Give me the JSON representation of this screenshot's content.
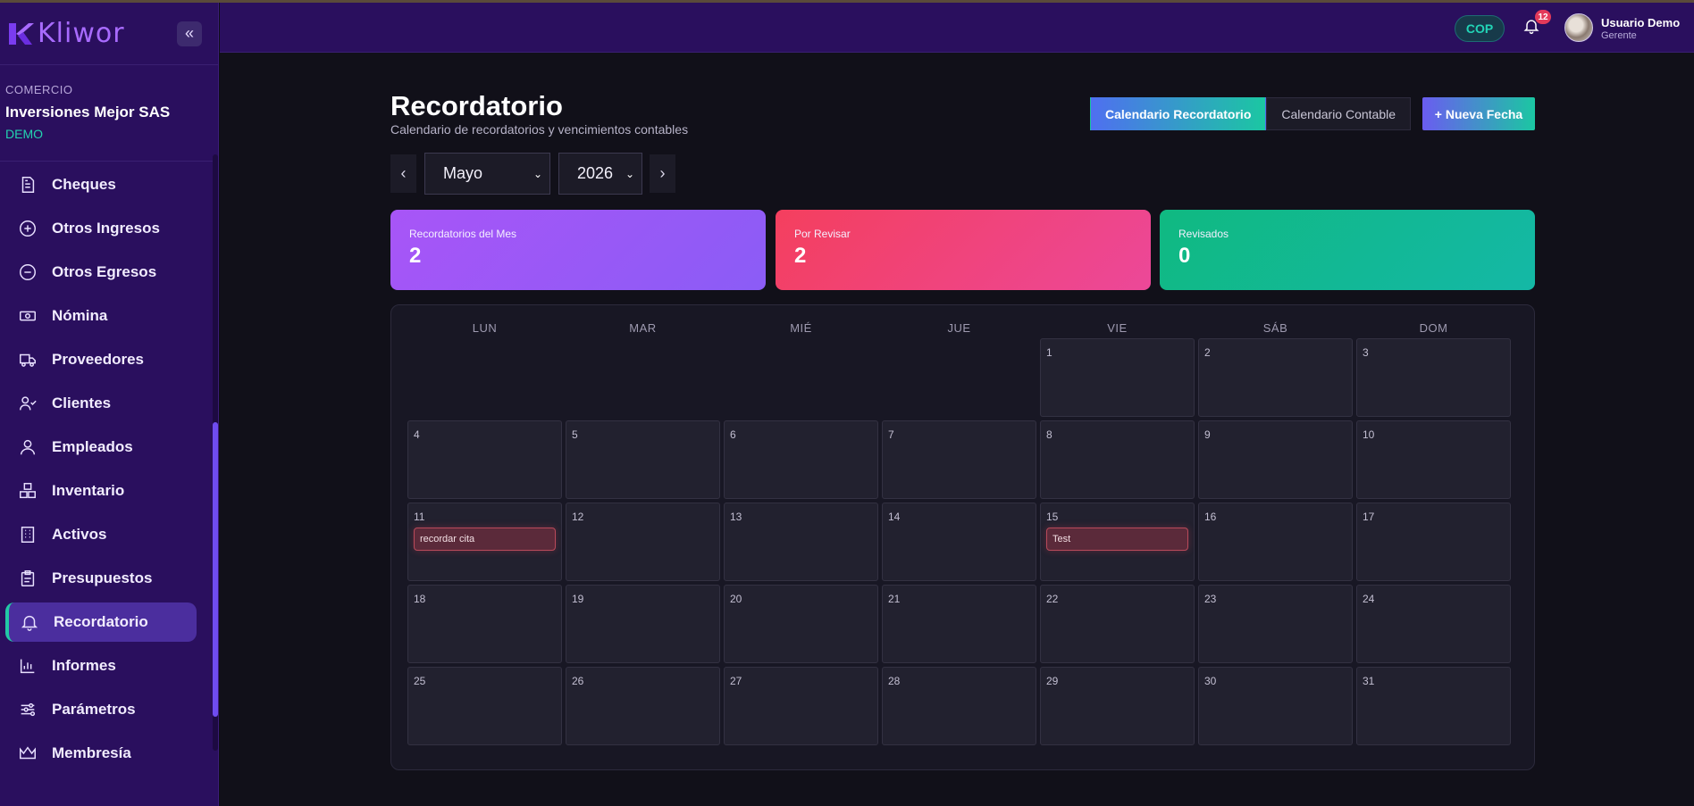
{
  "brand": {
    "name": "Kliwor",
    "collapse_icon": "double-chevron-left-icon"
  },
  "company": {
    "label": "COMERCIO",
    "name": "Inversiones Mejor SAS",
    "plan": "DEMO"
  },
  "sidebar": {
    "items": [
      {
        "label": "Cheques",
        "icon": "document-icon"
      },
      {
        "label": "Otros Ingresos",
        "icon": "plus-circle-icon"
      },
      {
        "label": "Otros Egresos",
        "icon": "minus-circle-icon"
      },
      {
        "label": "Nómina",
        "icon": "banknote-icon"
      },
      {
        "label": "Proveedores",
        "icon": "truck-icon"
      },
      {
        "label": "Clientes",
        "icon": "user-check-icon"
      },
      {
        "label": "Empleados",
        "icon": "user-icon"
      },
      {
        "label": "Inventario",
        "icon": "boxes-icon"
      },
      {
        "label": "Activos",
        "icon": "building-icon"
      },
      {
        "label": "Presupuestos",
        "icon": "clipboard-icon"
      },
      {
        "label": "Recordatorio",
        "icon": "bell-icon",
        "active": true
      },
      {
        "label": "Informes",
        "icon": "bar-chart-icon"
      },
      {
        "label": "Parámetros",
        "icon": "sliders-icon"
      },
      {
        "label": "Membresía",
        "icon": "crown-icon"
      }
    ]
  },
  "header": {
    "currency": "COP",
    "notifications": "12",
    "user_name": "Usuario Demo",
    "user_role": "Gerente"
  },
  "page": {
    "title": "Recordatorio",
    "subtitle": "Calendario de recordatorios y vencimientos contables",
    "tabs": [
      "Calendario Recordatorio",
      "Calendario Contable"
    ],
    "active_tab": 0,
    "new_button": "+ Nueva Fecha",
    "prev": "‹",
    "next": "›",
    "month": "Mayo",
    "year": "2026"
  },
  "stats": [
    {
      "label": "Recordatorios del Mes",
      "value": "2",
      "color_from": "#a855f7",
      "color_to": "#8b5cf6"
    },
    {
      "label": "Por Revisar",
      "value": "2",
      "color_from": "#f43f5e",
      "color_to": "#ec4899"
    },
    {
      "label": "Revisados",
      "value": "0",
      "color_from": "#10b981",
      "color_to": "#14b8a6"
    }
  ],
  "calendar": {
    "weekdays": [
      "LUN",
      "MAR",
      "MIÉ",
      "JUE",
      "VIE",
      "SÁB",
      "DOM"
    ],
    "first_weekday_index": 4,
    "days_in_month": 31,
    "events": [
      {
        "day": 11,
        "title": "recordar cita"
      },
      {
        "day": 15,
        "title": "Test"
      }
    ]
  }
}
